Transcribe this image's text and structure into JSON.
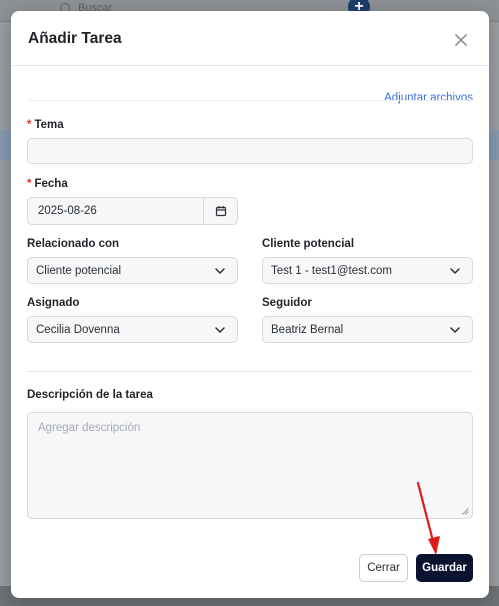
{
  "background": {
    "search_placeholder": "Buscar"
  },
  "modal": {
    "title": "Añadir Tarea",
    "attach_link": "Adjuntar archivos",
    "tema": {
      "label": "Tema",
      "required_mark": "*",
      "value": ""
    },
    "fecha": {
      "label": "Fecha",
      "required_mark": "*",
      "value": "2025-08-26"
    },
    "relacionado_con": {
      "label": "Relacionado con",
      "value": "Cliente potencial"
    },
    "cliente_potencial": {
      "label": "Cliente potencial",
      "value": "Test 1 - test1@test.com"
    },
    "asignado": {
      "label": "Asignado",
      "value": "Cecilia Dovenna"
    },
    "seguidor": {
      "label": "Seguidor",
      "value": "Beatriz Bernal"
    },
    "descripcion": {
      "label": "Descripción de la tarea",
      "placeholder": "Agregar descripción",
      "value": ""
    },
    "buttons": {
      "cancel": "Cerrar",
      "save": "Guardar"
    }
  },
  "colors": {
    "primary_button": "#0b1230",
    "link": "#3b6fd6",
    "required": "#e0312f",
    "annotation_arrow": "#e01b1b"
  },
  "icons": [
    "close-icon",
    "calendar-icon",
    "chevron-down-icon",
    "search-icon",
    "plus-icon",
    "resize-handle-icon",
    "arrow-annotation-icon"
  ]
}
